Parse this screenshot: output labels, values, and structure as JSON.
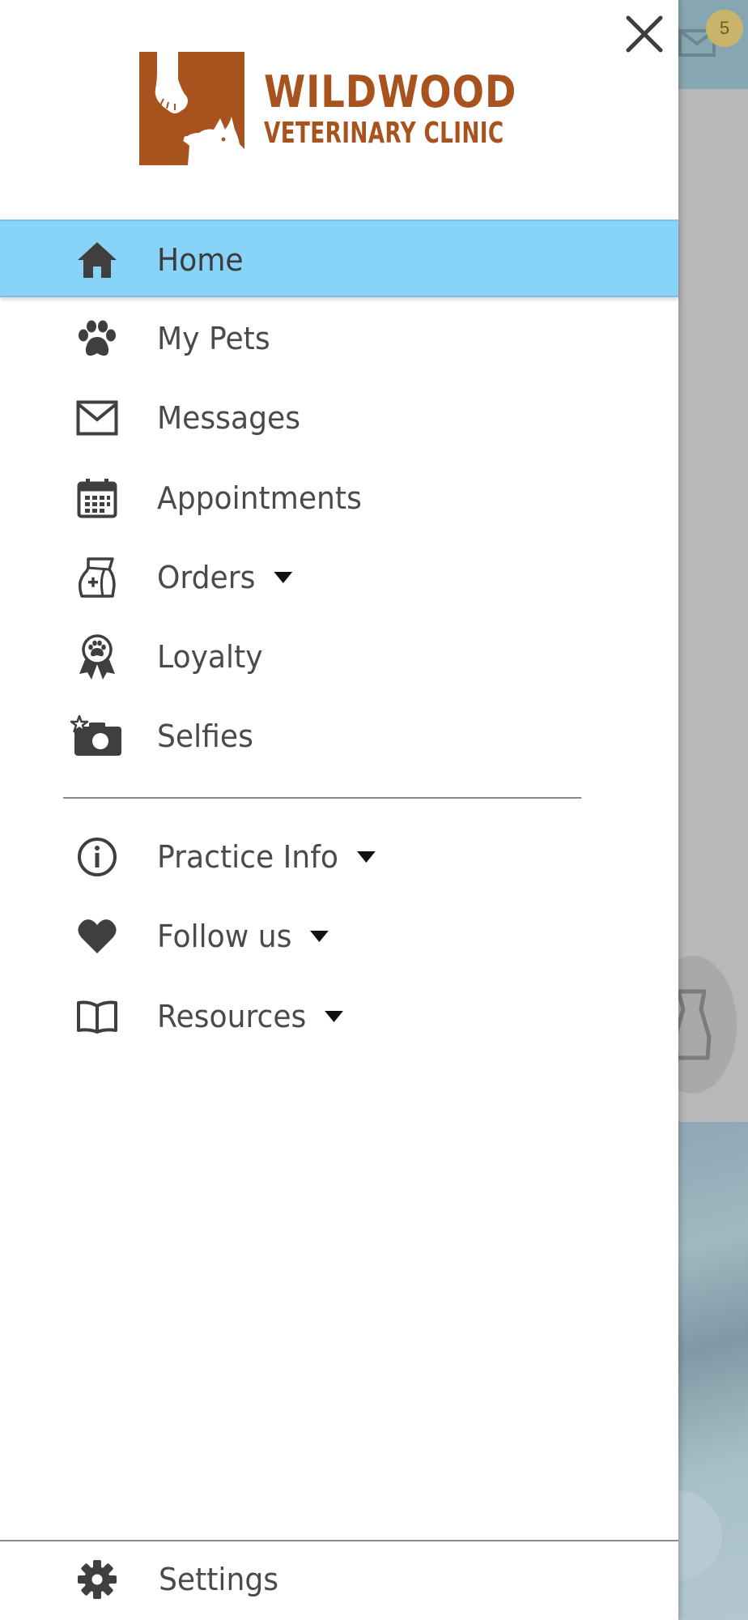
{
  "logo": {
    "name": "WILDWOOD",
    "subtitle": "VETERINARY CLINIC",
    "color": "#a8521e"
  },
  "background": {
    "badge_count": "5"
  },
  "menu": {
    "items": [
      {
        "label": "Home",
        "icon": "home-icon"
      },
      {
        "label": "My Pets",
        "icon": "paw-icon"
      },
      {
        "label": "Messages",
        "icon": "envelope-icon"
      },
      {
        "label": "Appointments",
        "icon": "calendar-icon"
      },
      {
        "label": "Orders",
        "icon": "food-bag-icon",
        "expandable": true
      },
      {
        "label": "Loyalty",
        "icon": "award-ribbon-icon"
      },
      {
        "label": "Selfies",
        "icon": "camera-icon"
      }
    ],
    "secondary": [
      {
        "label": "Practice Info",
        "icon": "info-icon",
        "expandable": true
      },
      {
        "label": "Follow us",
        "icon": "heart-icon",
        "expandable": true
      },
      {
        "label": "Resources",
        "icon": "book-icon",
        "expandable": true
      }
    ],
    "settings_label": "Settings",
    "active_color": "#87d4f8"
  }
}
